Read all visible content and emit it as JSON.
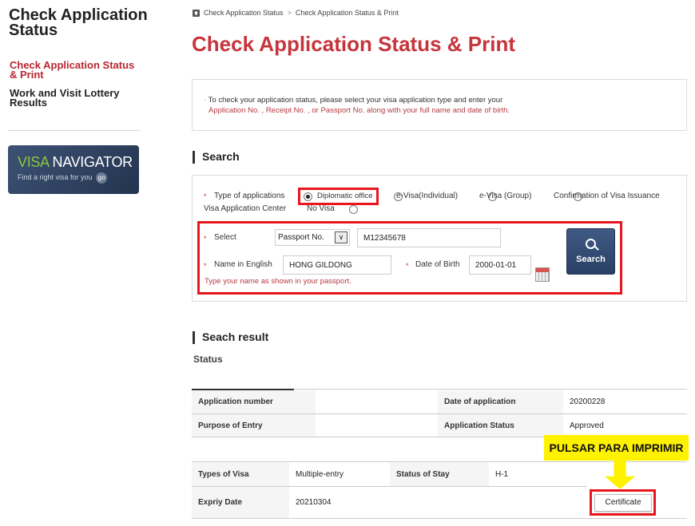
{
  "sidebar": {
    "title": "Check Application Status",
    "items": [
      {
        "label": "Check Application Status & Print",
        "active": true
      },
      {
        "label": "Work and Visit Lottery Results",
        "active": false
      }
    ],
    "banner": {
      "visa": "VISA",
      "navigator": " NAVIGATOR",
      "subtitle": "Find a right visa for you",
      "go": "go"
    }
  },
  "breadcrumb": [
    "Check Application Status",
    ">",
    "Check Application Status & Print"
  ],
  "page_title": "Check Application Status & Print",
  "info": {
    "line1": "To check your application status, please select your visa application type and enter your",
    "line2": "Application No. , Receipt No. , or Passport No. along with your full name and date of birth."
  },
  "search": {
    "heading": "Search",
    "type_label": "Type of applications",
    "types": [
      {
        "label": "Diplomatic office",
        "selected": true
      },
      {
        "label": "e-Visa(Individual)",
        "selected": false
      },
      {
        "label": "e-Visa (Group)",
        "selected": false
      },
      {
        "label": "Confirmation of Visa Issuance",
        "selected": false
      },
      {
        "label": "Visa Application Center",
        "selected": false
      },
      {
        "label": "No Visa",
        "selected": false
      }
    ],
    "select_label": "Select",
    "select_value": "Passport No.",
    "number_value": "M12345678",
    "name_label": "Name in English",
    "name_value": "HONG GILDONG",
    "dob_label": "Date of Birth",
    "dob_value": "2000-01-01",
    "hint": "Type your name as shown in your passport.",
    "button": "Search"
  },
  "result": {
    "heading": "Seach result",
    "status_heading": "Status",
    "table1": [
      [
        "Application number",
        "",
        "Date of application",
        "20200228"
      ],
      [
        "Purpose of Entry",
        "",
        "Application Status",
        "Approved"
      ]
    ],
    "table2": [
      [
        "Types of Visa",
        "Multiple-entry",
        "Status of Stay",
        "H-1"
      ],
      [
        "Expriy Date",
        "20210304"
      ]
    ],
    "certificate": "Certificate"
  },
  "annotation": {
    "callout": "PULSAR PARA IMPRIMIR",
    "color": "#fff200",
    "highlight": "#e8161e"
  }
}
